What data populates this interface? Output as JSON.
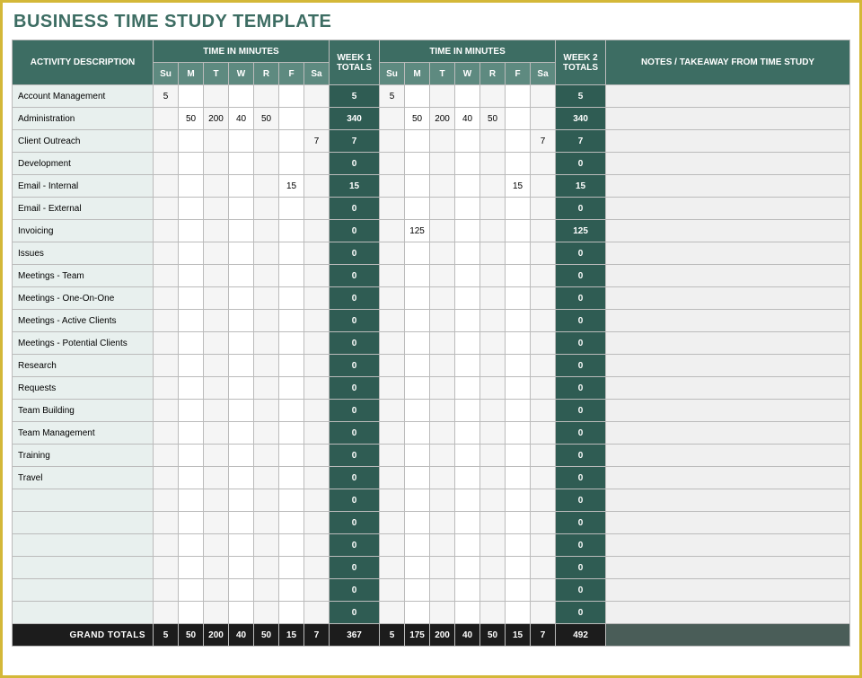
{
  "title": "BUSINESS TIME STUDY TEMPLATE",
  "headers": {
    "activity": "ACTIVITY DESCRIPTION",
    "time_in_minutes": "TIME IN MINUTES",
    "week1_totals": "WEEK 1 TOTALS",
    "week2_totals": "WEEK 2 TOTALS",
    "notes": "NOTES / TAKEAWAY FROM TIME STUDY",
    "days": [
      "Su",
      "M",
      "T",
      "W",
      "R",
      "F",
      "Sa"
    ],
    "grand_totals": "GRAND TOTALS"
  },
  "rows": [
    {
      "activity": "Account Management",
      "w1": [
        "5",
        "",
        "",
        "",
        "",
        "",
        ""
      ],
      "t1": "5",
      "w2": [
        "5",
        "",
        "",
        "",
        "",
        "",
        ""
      ],
      "t2": "5",
      "notes": ""
    },
    {
      "activity": "Administration",
      "w1": [
        "",
        "50",
        "200",
        "40",
        "50",
        "",
        ""
      ],
      "t1": "340",
      "w2": [
        "",
        "50",
        "200",
        "40",
        "50",
        "",
        ""
      ],
      "t2": "340",
      "notes": ""
    },
    {
      "activity": "Client Outreach",
      "w1": [
        "",
        "",
        "",
        "",
        "",
        "",
        "7"
      ],
      "t1": "7",
      "w2": [
        "",
        "",
        "",
        "",
        "",
        "",
        "7"
      ],
      "t2": "7",
      "notes": ""
    },
    {
      "activity": "Development",
      "w1": [
        "",
        "",
        "",
        "",
        "",
        "",
        ""
      ],
      "t1": "0",
      "w2": [
        "",
        "",
        "",
        "",
        "",
        "",
        ""
      ],
      "t2": "0",
      "notes": ""
    },
    {
      "activity": "Email - Internal",
      "w1": [
        "",
        "",
        "",
        "",
        "",
        "15",
        ""
      ],
      "t1": "15",
      "w2": [
        "",
        "",
        "",
        "",
        "",
        "15",
        ""
      ],
      "t2": "15",
      "notes": ""
    },
    {
      "activity": "Email - External",
      "w1": [
        "",
        "",
        "",
        "",
        "",
        "",
        ""
      ],
      "t1": "0",
      "w2": [
        "",
        "",
        "",
        "",
        "",
        "",
        ""
      ],
      "t2": "0",
      "notes": ""
    },
    {
      "activity": "Invoicing",
      "w1": [
        "",
        "",
        "",
        "",
        "",
        "",
        ""
      ],
      "t1": "0",
      "w2": [
        "",
        "125",
        "",
        "",
        "",
        "",
        ""
      ],
      "t2": "125",
      "notes": ""
    },
    {
      "activity": "Issues",
      "w1": [
        "",
        "",
        "",
        "",
        "",
        "",
        ""
      ],
      "t1": "0",
      "w2": [
        "",
        "",
        "",
        "",
        "",
        "",
        ""
      ],
      "t2": "0",
      "notes": ""
    },
    {
      "activity": "Meetings - Team",
      "w1": [
        "",
        "",
        "",
        "",
        "",
        "",
        ""
      ],
      "t1": "0",
      "w2": [
        "",
        "",
        "",
        "",
        "",
        "",
        ""
      ],
      "t2": "0",
      "notes": ""
    },
    {
      "activity": "Meetings - One-On-One",
      "w1": [
        "",
        "",
        "",
        "",
        "",
        "",
        ""
      ],
      "t1": "0",
      "w2": [
        "",
        "",
        "",
        "",
        "",
        "",
        ""
      ],
      "t2": "0",
      "notes": ""
    },
    {
      "activity": "Meetings - Active Clients",
      "w1": [
        "",
        "",
        "",
        "",
        "",
        "",
        ""
      ],
      "t1": "0",
      "w2": [
        "",
        "",
        "",
        "",
        "",
        "",
        ""
      ],
      "t2": "0",
      "notes": ""
    },
    {
      "activity": "Meetings - Potential Clients",
      "w1": [
        "",
        "",
        "",
        "",
        "",
        "",
        ""
      ],
      "t1": "0",
      "w2": [
        "",
        "",
        "",
        "",
        "",
        "",
        ""
      ],
      "t2": "0",
      "notes": ""
    },
    {
      "activity": "Research",
      "w1": [
        "",
        "",
        "",
        "",
        "",
        "",
        ""
      ],
      "t1": "0",
      "w2": [
        "",
        "",
        "",
        "",
        "",
        "",
        ""
      ],
      "t2": "0",
      "notes": ""
    },
    {
      "activity": "Requests",
      "w1": [
        "",
        "",
        "",
        "",
        "",
        "",
        ""
      ],
      "t1": "0",
      "w2": [
        "",
        "",
        "",
        "",
        "",
        "",
        ""
      ],
      "t2": "0",
      "notes": ""
    },
    {
      "activity": "Team Building",
      "w1": [
        "",
        "",
        "",
        "",
        "",
        "",
        ""
      ],
      "t1": "0",
      "w2": [
        "",
        "",
        "",
        "",
        "",
        "",
        ""
      ],
      "t2": "0",
      "notes": ""
    },
    {
      "activity": "Team Management",
      "w1": [
        "",
        "",
        "",
        "",
        "",
        "",
        ""
      ],
      "t1": "0",
      "w2": [
        "",
        "",
        "",
        "",
        "",
        "",
        ""
      ],
      "t2": "0",
      "notes": ""
    },
    {
      "activity": "Training",
      "w1": [
        "",
        "",
        "",
        "",
        "",
        "",
        ""
      ],
      "t1": "0",
      "w2": [
        "",
        "",
        "",
        "",
        "",
        "",
        ""
      ],
      "t2": "0",
      "notes": ""
    },
    {
      "activity": "Travel",
      "w1": [
        "",
        "",
        "",
        "",
        "",
        "",
        ""
      ],
      "t1": "0",
      "w2": [
        "",
        "",
        "",
        "",
        "",
        "",
        ""
      ],
      "t2": "0",
      "notes": ""
    },
    {
      "activity": "",
      "w1": [
        "",
        "",
        "",
        "",
        "",
        "",
        ""
      ],
      "t1": "0",
      "w2": [
        "",
        "",
        "",
        "",
        "",
        "",
        ""
      ],
      "t2": "0",
      "notes": ""
    },
    {
      "activity": "",
      "w1": [
        "",
        "",
        "",
        "",
        "",
        "",
        ""
      ],
      "t1": "0",
      "w2": [
        "",
        "",
        "",
        "",
        "",
        "",
        ""
      ],
      "t2": "0",
      "notes": ""
    },
    {
      "activity": "",
      "w1": [
        "",
        "",
        "",
        "",
        "",
        "",
        ""
      ],
      "t1": "0",
      "w2": [
        "",
        "",
        "",
        "",
        "",
        "",
        ""
      ],
      "t2": "0",
      "notes": ""
    },
    {
      "activity": "",
      "w1": [
        "",
        "",
        "",
        "",
        "",
        "",
        ""
      ],
      "t1": "0",
      "w2": [
        "",
        "",
        "",
        "",
        "",
        "",
        ""
      ],
      "t2": "0",
      "notes": ""
    },
    {
      "activity": "",
      "w1": [
        "",
        "",
        "",
        "",
        "",
        "",
        ""
      ],
      "t1": "0",
      "w2": [
        "",
        "",
        "",
        "",
        "",
        "",
        ""
      ],
      "t2": "0",
      "notes": ""
    },
    {
      "activity": "",
      "w1": [
        "",
        "",
        "",
        "",
        "",
        "",
        ""
      ],
      "t1": "0",
      "w2": [
        "",
        "",
        "",
        "",
        "",
        "",
        ""
      ],
      "t2": "0",
      "notes": ""
    }
  ],
  "grand": {
    "w1": [
      "5",
      "50",
      "200",
      "40",
      "50",
      "15",
      "7"
    ],
    "t1": "367",
    "w2": [
      "5",
      "175",
      "200",
      "40",
      "50",
      "15",
      "7"
    ],
    "t2": "492"
  }
}
